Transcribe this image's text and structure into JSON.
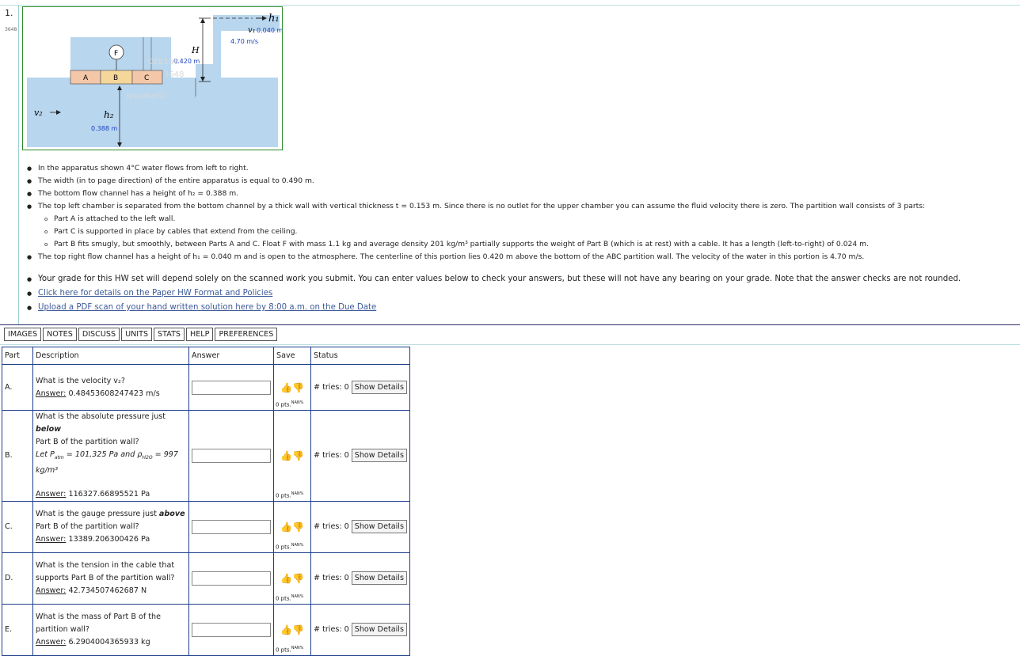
{
  "question": {
    "number": "1.",
    "id": "3648"
  },
  "figure": {
    "labels": {
      "h1": "h₁",
      "v1": "v₁",
      "h1_value": "0.040 m",
      "v1_value": "4.70 m/s",
      "F": "F",
      "H": "H",
      "H_value": "0.420 m",
      "A": "A",
      "B": "B",
      "C": "C",
      "v2": "v₂",
      "h2": "h₂",
      "h2_value": "0.388 m",
      "watermark_1": "CEE158",
      "watermark_2": "2023-2024",
      "watermark_3": "3648",
      "watermark_4": "(psarkar2)"
    },
    "colors": {
      "water": "#b8d6ee",
      "wall": "#86a9d6",
      "partA": "#f3c7a8",
      "partB": "#f6d79a",
      "partC": "#f3c7a8",
      "box": "#2b8a2b"
    }
  },
  "description": [
    {
      "text": "In the apparatus shown 4°C water flows from left to right.",
      "level": 1
    },
    {
      "text": "The width (in to page direction) of the entire apparatus is equal to 0.490 m.",
      "level": 1
    },
    {
      "text": "The bottom flow channel has a height of h₂ = 0.388 m.",
      "level": 1
    },
    {
      "text": "The top left chamber is separated from the bottom channel by a thick wall with vertical thickness t = 0.153 m. Since there is no outlet for the upper chamber you can assume the fluid velocity there is zero. The partition wall consists of 3 parts:",
      "level": 1
    },
    {
      "text": "Part A is attached to the left wall.",
      "level": 2
    },
    {
      "text": "Part C is supported in place by cables that extend from the ceiling.",
      "level": 2
    },
    {
      "text": "Part B fits smugly, but smoothly, between Parts A and C. Float F with mass 1.1 kg and average density 201 kg/m³ partially supports the weight of Part B (which is at rest) with a cable. It has a length (left-to-right) of 0.024 m.",
      "level": 2
    },
    {
      "text": "The top right flow channel has a height of h₁ = 0.040 m and is open to the atmosphere. The centerline of this portion lies 0.420 m above the bottom of the ABC partition wall. The velocity of the water in this portion is 4.70 m/s.",
      "level": 1
    }
  ],
  "notes": {
    "grade_text": "Your grade for this HW set will depend solely on the scanned work you submit. You can enter values below to check your answers, but these will not have any bearing on your grade. Note that the answer checks are not rounded.",
    "link1": "Click here for details on the Paper HW Format and Policies",
    "link2": "Upload a PDF scan of your hand written solution here by 8:00 a.m. on the Due Date"
  },
  "tabs": [
    "IMAGES",
    "NOTES",
    "DISCUSS",
    "UNITS",
    "STATS",
    "HELP",
    "PREFERENCES"
  ],
  "table": {
    "headers": {
      "part": "Part",
      "description": "Description",
      "answer": "Answer",
      "save": "Save",
      "status": "Status"
    },
    "answer_label": "Answer:",
    "pts": "0 pts.",
    "pts_sup": "NAN%",
    "tries": "# tries: 0",
    "show_details": "Show Details",
    "rows": [
      {
        "part": "A.",
        "q1": "What is the velocity v₂?",
        "answer": "0.48453608247423 m/s"
      },
      {
        "part": "B.",
        "q1": "What is the absolute pressure just ",
        "q1b": "below",
        "q2": "Part B of the partition wall?",
        "q3": "Let P",
        "q3sub": "atm",
        "q3b": " = 101,325 Pa and ρ",
        "q3sub2": "H2O",
        "q3c": " = 997",
        "q4": "kg/m³",
        "answer": "116327.66895521 Pa"
      },
      {
        "part": "C.",
        "q1": "What is the gauge pressure just ",
        "q1b": "above",
        "q2": "Part B of the partition wall?",
        "answer": "13389.206300426 Pa"
      },
      {
        "part": "D.",
        "q1": "What is the tension in the cable that",
        "q2": "supports Part B of the partition wall?",
        "answer": "42.734507462687 N"
      },
      {
        "part": "E.",
        "q1": "What is the mass of Part B of the",
        "q2": "partition wall?",
        "answer": "6.2904004365933 kg"
      }
    ]
  }
}
